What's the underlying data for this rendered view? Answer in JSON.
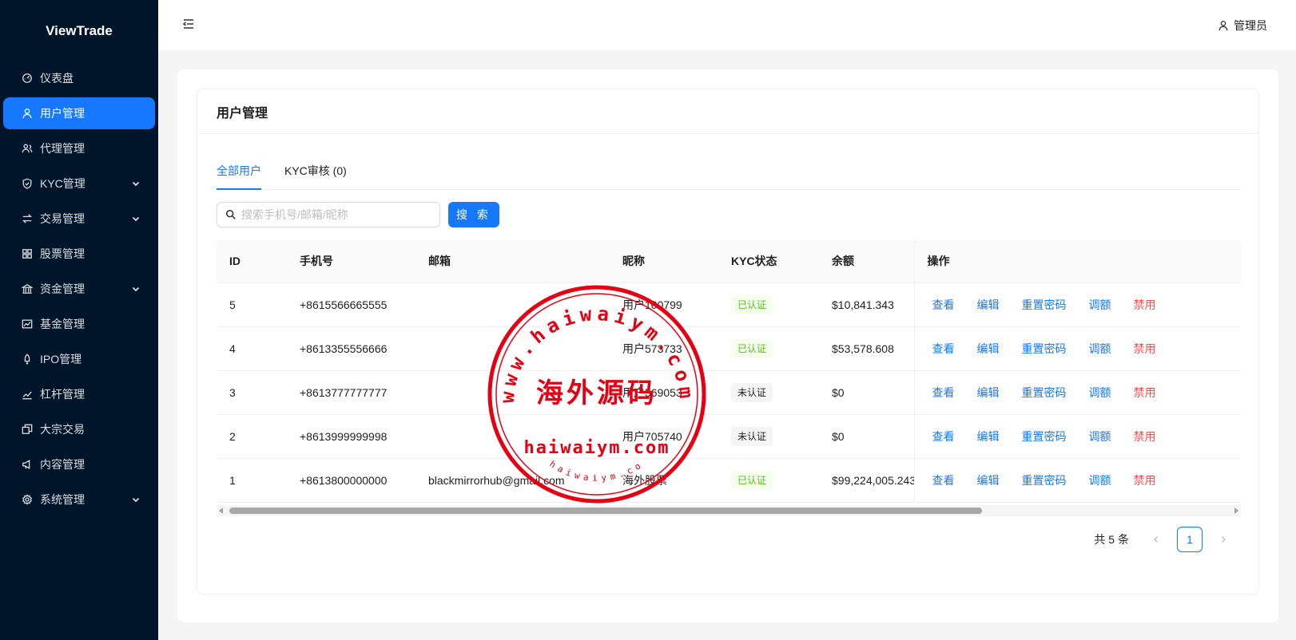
{
  "app": {
    "title": "ViewTrade"
  },
  "sidebar": {
    "items": [
      {
        "label": "仪表盘",
        "icon": "dashboard-icon"
      },
      {
        "label": "用户管理",
        "icon": "user-icon",
        "active": true
      },
      {
        "label": "代理管理",
        "icon": "team-icon"
      },
      {
        "label": "KYC管理",
        "icon": "shield-icon",
        "expandable": true
      },
      {
        "label": "交易管理",
        "icon": "swap-icon",
        "expandable": true
      },
      {
        "label": "股票管理",
        "icon": "grid-icon"
      },
      {
        "label": "资金管理",
        "icon": "bank-icon",
        "expandable": true
      },
      {
        "label": "基金管理",
        "icon": "fund-icon"
      },
      {
        "label": "IPO管理",
        "icon": "rocket-icon"
      },
      {
        "label": "杠杆管理",
        "icon": "stock-icon"
      },
      {
        "label": "大宗交易",
        "icon": "block-icon"
      },
      {
        "label": "内容管理",
        "icon": "notification-icon"
      },
      {
        "label": "系统管理",
        "icon": "setting-icon",
        "expandable": true
      }
    ]
  },
  "header": {
    "user_label": "管理员"
  },
  "page": {
    "title": "用户管理"
  },
  "tabs": [
    {
      "label": "全部用户",
      "active": true
    },
    {
      "label": "KYC审核 (0)"
    }
  ],
  "search": {
    "placeholder": "搜索手机号/邮箱/昵称",
    "button_label": "搜 索"
  },
  "table": {
    "columns": [
      "ID",
      "手机号",
      "邮箱",
      "昵称",
      "KYC状态",
      "余额",
      "操作"
    ],
    "rows": [
      {
        "id": "5",
        "phone": "+8615566665555",
        "email": "",
        "nickname": "用户100799",
        "kyc": "已认证",
        "balance": "$10,841.343"
      },
      {
        "id": "4",
        "phone": "+8613355556666",
        "email": "",
        "nickname": "用户573733",
        "kyc": "已认证",
        "balance": "$53,578.608"
      },
      {
        "id": "3",
        "phone": "+8613777777777",
        "email": "",
        "nickname": "用户569053",
        "kyc": "未认证",
        "balance": "$0"
      },
      {
        "id": "2",
        "phone": "+8613999999998",
        "email": "",
        "nickname": "用户705740",
        "kyc": "未认证",
        "balance": "$0"
      },
      {
        "id": "1",
        "phone": "+8613800000000",
        "email": "blackmirrorhub@gmail.com",
        "nickname": "海外股票",
        "kyc": "已认证",
        "balance": "$99,224,005.243"
      }
    ],
    "actions": [
      "查看",
      "编辑",
      "重置密码",
      "调额",
      "禁用"
    ]
  },
  "pagination": {
    "total_label": "共 5 条",
    "current": "1"
  },
  "watermark": {
    "url_top": "www.haiwaiym.com",
    "center": "海外源码",
    "url_mid": "haiwaiym.com",
    "url_bottom": "haiwaiym.co",
    "color": "#e60012"
  },
  "colors": {
    "primary": "#1677ff",
    "sidebar_bg": "#001529",
    "success": "#52c41a",
    "danger": "#ff4d4f"
  }
}
